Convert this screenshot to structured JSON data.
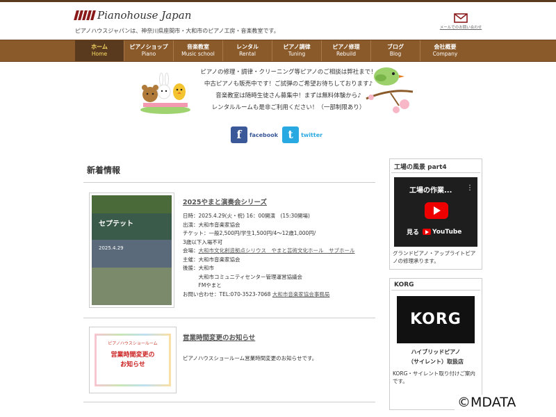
{
  "header": {
    "logo_text": "Pianohouse Japan",
    "tagline": "ピアノハウスジャパンは、神奈川県座間市・大和市のピアノ工房・音楽教室です。",
    "mail_label": "メールでのお問い合わせ"
  },
  "nav": [
    {
      "jp": "ホーム",
      "en": "Home"
    },
    {
      "jp": "ピアノショップ",
      "en": "Piano"
    },
    {
      "jp": "音楽教室",
      "en": "Music school"
    },
    {
      "jp": "レンタル",
      "en": "Rental"
    },
    {
      "jp": "ピアノ調律",
      "en": "Tuning"
    },
    {
      "jp": "ピアノ修理",
      "en": "Rebuild"
    },
    {
      "jp": "ブログ",
      "en": "Blog"
    },
    {
      "jp": "会社概要",
      "en": "Company"
    }
  ],
  "banner": {
    "lines": [
      "ピアノの修理・調律・クリーニング等ピアノのご相談は弊社まで！",
      "中古ピアノも販売中です！ご試弾のご希望お待ちしております♪",
      "音楽教室は随時生徒さん募集中！まずは無料体験から♪",
      "レンタルルームも是非ご利用ください！（一部制限あり）"
    ]
  },
  "social": {
    "facebook": "facebook",
    "twitter": "twitter"
  },
  "news": {
    "heading": "新着情報",
    "article1": {
      "title": "2025やまと演奏会シリーズ",
      "poster_title": "セプテット",
      "poster_date": "2025.4.29",
      "lines": [
        "日時：2025.4.29(火・祝) 16：00開演　(15:30開場)",
        "出演：大和市音楽家協会",
        "チケット：一般2,500円/学生1,500円/4～12歳1,000円/",
        "3歳以下入場不可",
        "会場：",
        "主催：大和市音楽家協会",
        "後援：大和市",
        "　　　大和市コミュニティセンター管理運営協議会",
        "　　　FMやまと",
        "お問い合わせ：TEL:070-3523-7068"
      ],
      "venue_link": "大和市文化創造拠点シリウス　やまと芸術文化ホール　サブホール",
      "contact_link": "大和市音楽家協会事務局"
    },
    "article2": {
      "title": "営業時間変更のお知らせ",
      "body": "ピアノハウスショールーム営業時間変更のお知らせです。",
      "notice_top": "ピアノハウスショールーム",
      "notice_main1": "営業時間変更の",
      "notice_main2": "お知らせ"
    }
  },
  "sidebar": {
    "box1": {
      "title": "工場の風景 part4",
      "video_title": "工場の作業...",
      "watch_on": "見る",
      "youtube": "YouTube",
      "caption": "グランドピアノ・アップライトピアノの修理承ります。"
    },
    "box2": {
      "title": "KORG",
      "logo": "KORG",
      "caption1": "ハイブリッドピアノ",
      "caption2": "（サイレント）取扱店",
      "text": "KORG・サイレント取り付けご案内です。"
    }
  },
  "watermark": "©MDATA",
  "colors": {
    "nav_bg": "#8a5a2a",
    "nav_active": "#5a3a1e",
    "nav_active_text": "#ffe066",
    "facebook": "#3b5998",
    "twitter": "#29a9e1"
  }
}
